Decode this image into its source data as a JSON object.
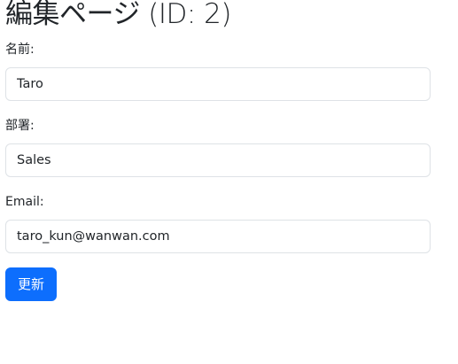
{
  "page": {
    "title": "編集ページ (ID: 2)"
  },
  "form": {
    "name": {
      "label": "名前:",
      "value": "Taro"
    },
    "department": {
      "label": "部署:",
      "value": "Sales"
    },
    "email": {
      "label": "Email:",
      "value": "taro_kun@wanwan.com"
    },
    "submit_label": "更新"
  },
  "colors": {
    "primary_button": "#0d6efd",
    "input_border": "#dee2e6",
    "text": "#212529"
  }
}
